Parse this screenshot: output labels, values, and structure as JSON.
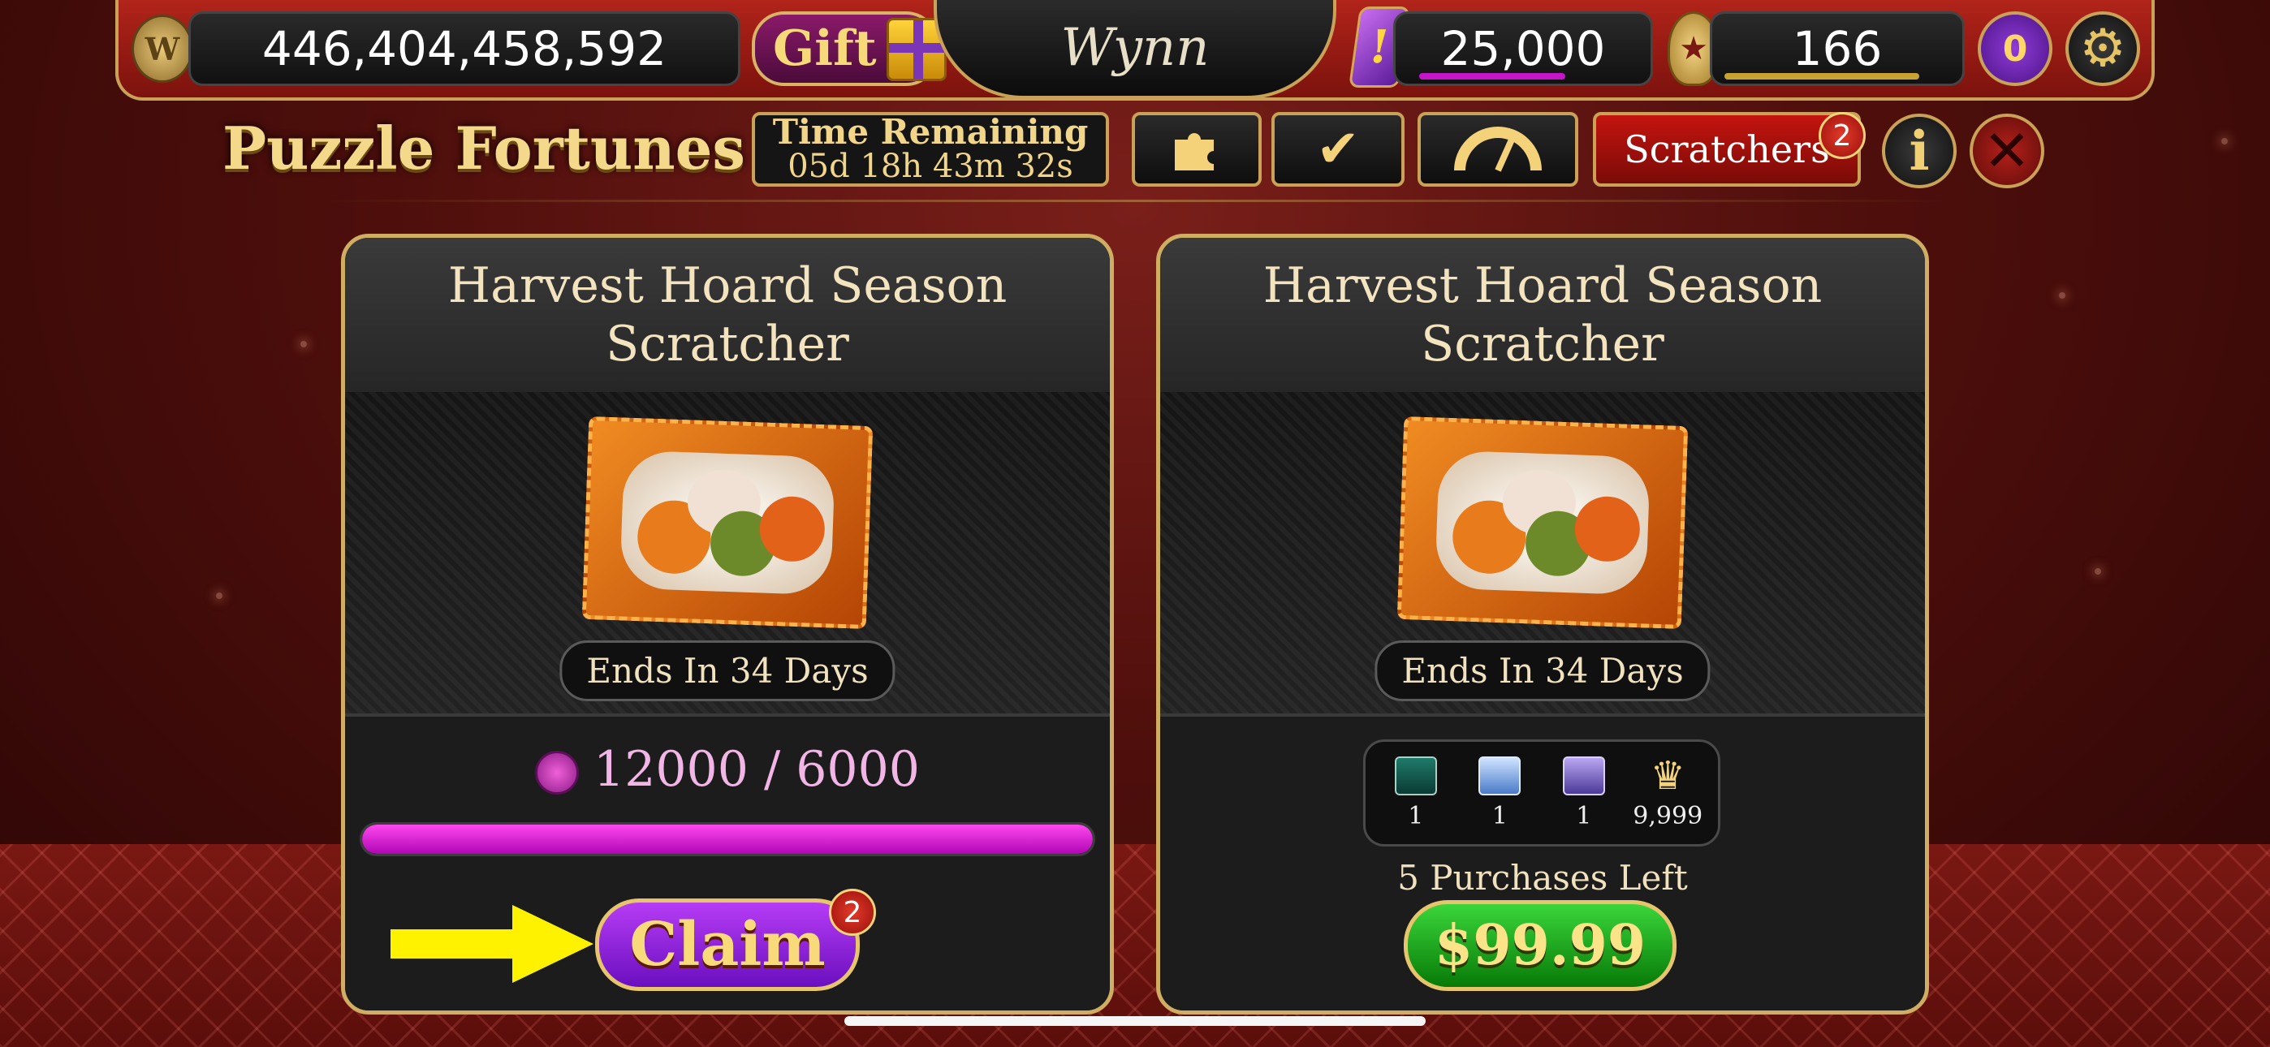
{
  "header": {
    "balance": "446,404,458,592",
    "gift_label": "Gift",
    "logo_text": "Wynn",
    "gems": "25,000",
    "level": "166",
    "vip_level": "0"
  },
  "subheader": {
    "title": "Puzzle Fortunes",
    "time_label": "Time Remaining",
    "time_value": "05d 18h 43m 32s",
    "tabs": {
      "scratchers_label": "Scratchers",
      "scratchers_badge": "2"
    }
  },
  "cards": [
    {
      "title": "Harvest Hoard Season Scratcher",
      "ends": "Ends In 34 Days",
      "progress_text": "12000 / 6000",
      "progress_fraction": 1.0,
      "claim_label": "Claim",
      "claim_badge": "2"
    },
    {
      "title": "Harvest Hoard Season Scratcher",
      "ends": "Ends In 34 Days",
      "rewards": [
        {
          "icon": "green-ticket-icon",
          "qty": "1"
        },
        {
          "icon": "blue-ticket-icon",
          "qty": "1"
        },
        {
          "icon": "purple-ticket-icon",
          "qty": "1"
        },
        {
          "icon": "crown-icon",
          "qty": "9,999"
        }
      ],
      "purchases_left": "5 Purchases Left",
      "price": "$99.99"
    }
  ],
  "colors": {
    "accent_gold": "#cfae63",
    "claim_purple": "#8a1fd6",
    "buy_green": "#0fa40f",
    "progress_magenta": "#e020d8"
  }
}
